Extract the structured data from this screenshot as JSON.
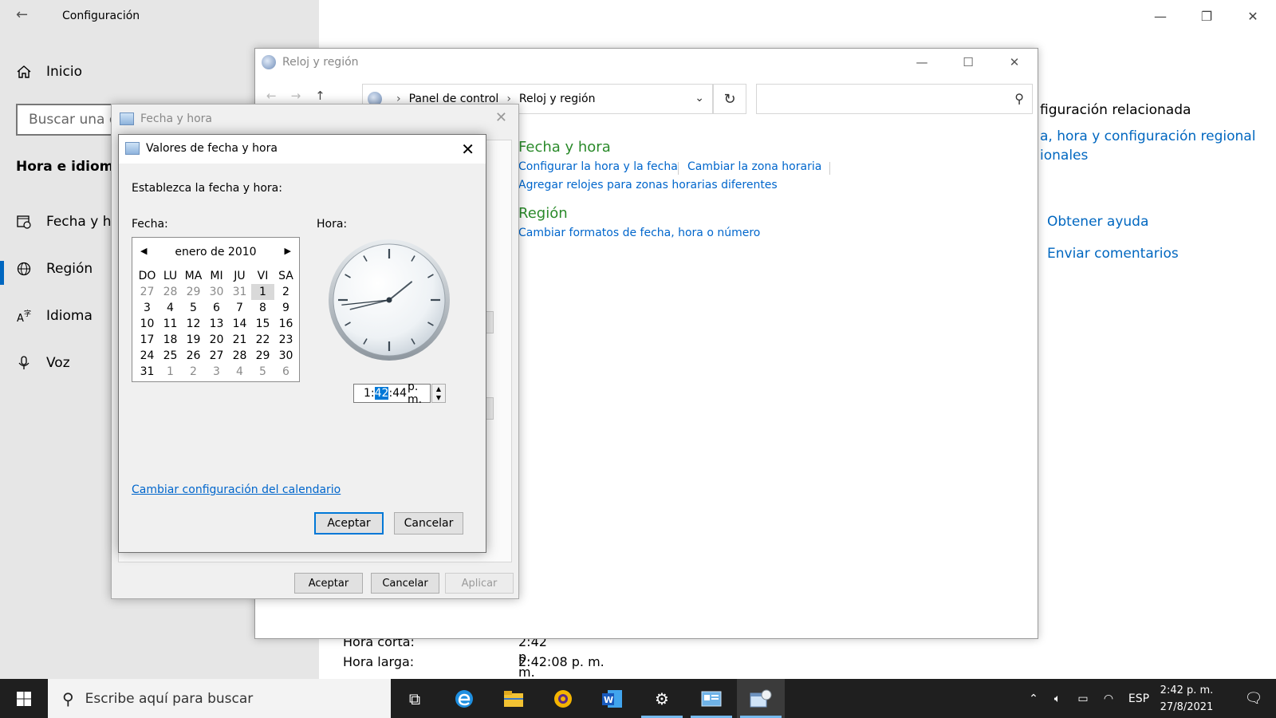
{
  "settings": {
    "title": "Configuración",
    "home_label": "Inicio",
    "search_placeholder": "Buscar una op",
    "section": "Hora e idioma",
    "nav": [
      "Fecha y ho",
      "Región",
      "Idioma",
      "Voz"
    ],
    "related_title": "figuración relacionada",
    "related_links": [
      "a, hora y configuración regional",
      "ionales"
    ],
    "help_links": [
      "Obtener ayuda",
      "Enviar comentarios"
    ],
    "rows": [
      {
        "label": "Hora corta:",
        "value": "2:42 p. m."
      },
      {
        "label": "Hora larga:",
        "value": "2:42:08 p. m."
      }
    ]
  },
  "control_panel": {
    "title": "Reloj y región",
    "address": [
      "Panel de control",
      "Reloj y región"
    ],
    "search_placeholder": "",
    "sections": [
      {
        "heading": "Fecha y hora",
        "links": [
          "Configurar la hora y la fecha",
          "Cambiar la zona horaria",
          "Agregar relojes para zonas horarias diferentes"
        ]
      },
      {
        "heading": "Región",
        "links": [
          "Cambiar formatos de fecha, hora o número"
        ]
      }
    ]
  },
  "fecha_hora": {
    "title": "Fecha y hora",
    "buttons": {
      "ok": "Aceptar",
      "cancel": "Cancelar",
      "apply": "Aplicar"
    }
  },
  "valores": {
    "title": "Valores de fecha y hora",
    "instruction": "Establezca la fecha y hora:",
    "date_label": "Fecha:",
    "time_label": "Hora:",
    "calendar": {
      "month": "enero de 2010",
      "weekdays": [
        "DO",
        "LU",
        "MA",
        "MI",
        "JU",
        "VI",
        "SA"
      ],
      "selected_day": "1"
    },
    "time": {
      "hour": "1",
      "minute": "42",
      "second": "44",
      "ampm": "p. m."
    },
    "clock": {
      "hour": 1,
      "minute": 42,
      "second": 44
    },
    "calendar_link": "Cambiar configuración del calendario",
    "ok": "Aceptar",
    "cancel": "Cancelar"
  },
  "taskbar": {
    "search_placeholder": "Escribe aquí para buscar",
    "language": "ESP",
    "time": "2:42 p. m.",
    "date": "27/8/2021"
  },
  "colors": {
    "accent": "#0078d7",
    "link": "#0066cc",
    "heading_green": "#2a8a2a",
    "taskbar": "#1f1f1f"
  }
}
